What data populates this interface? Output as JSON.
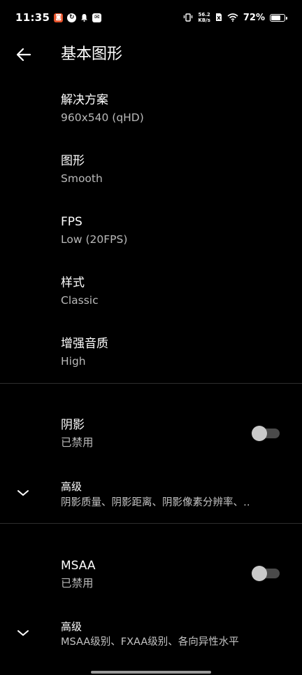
{
  "status_bar": {
    "time": "11:35",
    "net_speed_value": "56.2",
    "net_speed_unit": "KB/s",
    "battery_percent": "72%",
    "battery_level": 0.72
  },
  "header": {
    "title": "基本图形"
  },
  "settings": [
    {
      "title": "解决方案",
      "value": "960x540 (qHD)"
    },
    {
      "title": "图形",
      "value": "Smooth"
    },
    {
      "title": "FPS",
      "value": "Low (20FPS)"
    },
    {
      "title": "样式",
      "value": "Classic"
    },
    {
      "title": "增强音质",
      "value": "High"
    }
  ],
  "shadow": {
    "title": "阴影",
    "state": "已禁用",
    "enabled": false,
    "advanced_title": "高级",
    "advanced_desc": "阴影质量、阴影距离、阴影像素分辨率、‥"
  },
  "msaa": {
    "title": "MSAA",
    "state": "已禁用",
    "enabled": false,
    "advanced_title": "高级",
    "advanced_desc": "MSAA级别、FXAA级别、各向异性水平"
  },
  "colors": {
    "background": "#000000",
    "subtitle": "#b9b9b9",
    "divider": "#2e2e2e",
    "toggle_off_track": "#4a4a4a",
    "toggle_off_knob": "#c9c9c9"
  }
}
